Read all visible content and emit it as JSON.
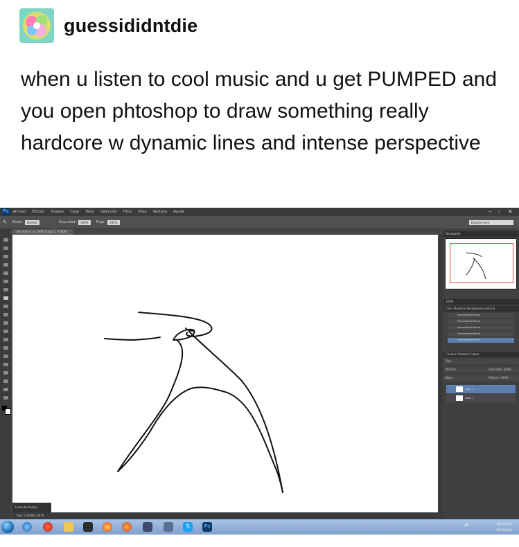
{
  "post": {
    "username": "guessididntdie",
    "caption": "when u listen to cool music and u get PUMPED and you open phtoshop to draw something really hardcore w dynamic lines and intense perspective"
  },
  "photoshop": {
    "logo": "Ps",
    "menu": [
      "Archivo",
      "Edición",
      "Imagen",
      "Capa",
      "Texto",
      "Selección",
      "Filtro",
      "Vista",
      "Ventana",
      "Ayuda"
    ],
    "options": {
      "mode_label": "Modo:",
      "mode_value": "Normal",
      "opacity_label": "Opacidad:",
      "opacity_value": "100%",
      "flow_label": "Flujo:",
      "flow_value": "100%",
      "workspace": "Espacio esen."
    },
    "document_tab": "Sin título-1 al 100% (Capa 1, RGB/8) *",
    "status": "Doc: 5,93 M/1,96 M",
    "timeline_label": "Línea de tiempo",
    "panels": {
      "navigator": "Navegador",
      "zoom": "100%",
      "history_tabs": "Color  Muestras  Histograma  Historia",
      "history_items": [
        "Herramienta Pincel",
        "Herramienta Pincel",
        "Herramienta Pincel",
        "Herramienta Pincel",
        "Herramienta Pincel"
      ],
      "layers_tabs": "Canales  Trazados  Capas",
      "layer_kind": "Tipo",
      "blend_mode": "Normal",
      "opacity": "Opacidad: 100%",
      "fill": "Relleno: 100%",
      "lock": "Bloq.:",
      "layers": [
        "Capa 1",
        "Capa 1"
      ]
    }
  },
  "taskbar": {
    "ps_label": "Ps",
    "time": "03:23 a.m.",
    "date": "11/11/2014",
    "lang": "ES"
  }
}
